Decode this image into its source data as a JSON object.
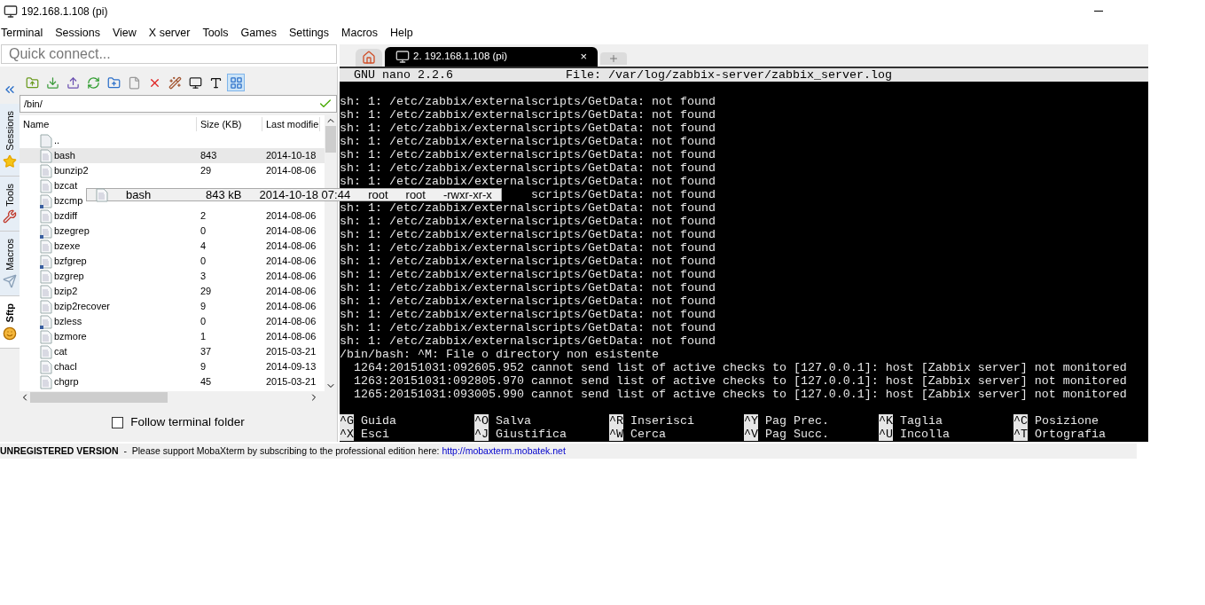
{
  "window": {
    "title": "192.168.1.108 (pi)"
  },
  "menu": [
    "Terminal",
    "Sessions",
    "View",
    "X server",
    "Tools",
    "Games",
    "Settings",
    "Macros",
    "Help"
  ],
  "quick_connect": {
    "placeholder": "Quick connect..."
  },
  "session_tabs": [
    {
      "kind": "home",
      "selected": false
    },
    {
      "kind": "session",
      "label": "2. 192.168.1.108 (pi)",
      "close": "×",
      "selected": true
    },
    {
      "kind": "new",
      "selected": false
    }
  ],
  "side_tabs": [
    {
      "label": "Sessions",
      "selected": false
    },
    {
      "label": "Tools",
      "selected": false
    },
    {
      "label": "Macros",
      "selected": false
    },
    {
      "label": "Sftp",
      "selected": true
    }
  ],
  "toolbar_buttons": [
    {
      "kind": "folder-up",
      "selected": false
    },
    {
      "kind": "download",
      "selected": false
    },
    {
      "kind": "upload",
      "selected": false
    },
    {
      "kind": "refresh",
      "selected": false
    },
    {
      "kind": "new-folder",
      "selected": false
    },
    {
      "kind": "new-file",
      "selected": false
    },
    {
      "kind": "delete",
      "selected": false
    },
    {
      "kind": "wand",
      "selected": false
    },
    {
      "kind": "terminal",
      "selected": false
    },
    {
      "kind": "text",
      "selected": false
    },
    {
      "kind": "view",
      "selected": true
    }
  ],
  "path": {
    "value": "/bin/"
  },
  "file_list": {
    "columns": [
      "Name",
      "Size (KB)",
      "Last modifie"
    ],
    "rows": [
      {
        "kind": "parent",
        "name": "..",
        "selected": false
      },
      {
        "kind": "file",
        "name": "bash",
        "size": "843",
        "date": "2014-10-18",
        "selected": true
      },
      {
        "kind": "file",
        "name": "bunzip2",
        "size": "29",
        "date": "2014-08-06",
        "selected": false
      },
      {
        "kind": "file",
        "name": "bzcat",
        "selected": false
      },
      {
        "kind": "link",
        "name": "bzcmp",
        "selected": false
      },
      {
        "kind": "file",
        "name": "bzdiff",
        "size": "2",
        "date": "2014-08-06",
        "selected": false
      },
      {
        "kind": "link",
        "name": "bzegrep",
        "size": "0",
        "date": "2014-08-06",
        "selected": false
      },
      {
        "kind": "file",
        "name": "bzexe",
        "size": "4",
        "date": "2014-08-06",
        "selected": false
      },
      {
        "kind": "link",
        "name": "bzfgrep",
        "size": "0",
        "date": "2014-08-06",
        "selected": false
      },
      {
        "kind": "file",
        "name": "bzgrep",
        "size": "3",
        "date": "2014-08-06",
        "selected": false
      },
      {
        "kind": "file",
        "name": "bzip2",
        "size": "29",
        "date": "2014-08-06",
        "selected": false
      },
      {
        "kind": "file",
        "name": "bzip2recover",
        "size": "9",
        "date": "2014-08-06",
        "selected": false
      },
      {
        "kind": "link",
        "name": "bzless",
        "size": "0",
        "date": "2014-08-06",
        "selected": false
      },
      {
        "kind": "file",
        "name": "bzmore",
        "size": "1",
        "date": "2014-08-06",
        "selected": false
      },
      {
        "kind": "file",
        "name": "cat",
        "size": "37",
        "date": "2015-03-21",
        "selected": false
      },
      {
        "kind": "file",
        "name": "chacl",
        "size": "9",
        "date": "2014-09-13",
        "selected": false
      },
      {
        "kind": "file",
        "name": "chgrp",
        "size": "45",
        "date": "2015-03-21",
        "selected": false
      }
    ]
  },
  "follow_terminal_folder": {
    "label": "Follow terminal folder",
    "checked": false
  },
  "tooltip": {
    "name": "bash",
    "size": "843 kB",
    "date": "2014-10-18 07:44",
    "owner": "root",
    "group": "root",
    "permissions": "-rwxr-xr-x"
  },
  "terminal": {
    "header": {
      "left": "GNU nano 2.2.6",
      "right": "File: /var/log/zabbix-server/zabbix_server.log"
    },
    "lines": [
      {
        "kind": "full",
        "text": "sh: 1: /etc/zabbix/externalscripts/GetData: not found"
      },
      {
        "kind": "full",
        "text": "sh: 1: /etc/zabbix/externalscripts/GetData: not found"
      },
      {
        "kind": "full",
        "text": "sh: 1: /etc/zabbix/externalscripts/GetData: not found"
      },
      {
        "kind": "full",
        "text": "sh: 1: /etc/zabbix/externalscripts/GetData: not found"
      },
      {
        "kind": "full",
        "text": "sh: 1: /etc/zabbix/externalscripts/GetData: not found"
      },
      {
        "kind": "full",
        "text": "sh: 1: /etc/zabbix/externalscripts/GetData: not found"
      },
      {
        "kind": "full",
        "text": "sh: 1: /etc/zabbix/externalscripts/GetData: not found"
      },
      {
        "kind": "covered",
        "text": "scripts/GetData: not found"
      },
      {
        "kind": "full",
        "text": "sh: 1: /etc/zabbix/externalscripts/GetData: not found"
      },
      {
        "kind": "full",
        "text": "sh: 1: /etc/zabbix/externalscripts/GetData: not found"
      },
      {
        "kind": "full",
        "text": "sh: 1: /etc/zabbix/externalscripts/GetData: not found"
      },
      {
        "kind": "full",
        "text": "sh: 1: /etc/zabbix/externalscripts/GetData: not found"
      },
      {
        "kind": "full",
        "text": "sh: 1: /etc/zabbix/externalscripts/GetData: not found"
      },
      {
        "kind": "full",
        "text": "sh: 1: /etc/zabbix/externalscripts/GetData: not found"
      },
      {
        "kind": "full",
        "text": "sh: 1: /etc/zabbix/externalscripts/GetData: not found"
      },
      {
        "kind": "full",
        "text": "sh: 1: /etc/zabbix/externalscripts/GetData: not found"
      },
      {
        "kind": "full",
        "text": "sh: 1: /etc/zabbix/externalscripts/GetData: not found"
      },
      {
        "kind": "full",
        "text": "sh: 1: /etc/zabbix/externalscripts/GetData: not found"
      },
      {
        "kind": "full",
        "text": "sh: 1: /etc/zabbix/externalscripts/GetData: not found"
      },
      {
        "kind": "full",
        "text": "/bin/bash: ^M: File o directory non esistente"
      },
      {
        "kind": "full",
        "text": "  1264:20151031:092605.952 cannot send list of active checks to [127.0.0.1]: host [Zabbix server] not monitored"
      },
      {
        "kind": "full",
        "text": "  1263:20151031:092805.970 cannot send list of active checks to [127.0.0.1]: host [Zabbix server] not monitored"
      },
      {
        "kind": "full",
        "text": "  1265:20151031:093005.990 cannot send list of active checks to [127.0.0.1]: host [Zabbix server] not monitored"
      }
    ],
    "shortcuts": [
      {
        "key": "^G",
        "label": "Guida"
      },
      {
        "key": "^O",
        "label": "Salva"
      },
      {
        "key": "^R",
        "label": "Inserisci"
      },
      {
        "key": "^Y",
        "label": "Pag Prec."
      },
      {
        "key": "^K",
        "label": "Taglia"
      },
      {
        "key": "^C",
        "label": "Posizione"
      },
      {
        "key": "^X",
        "label": "Esci"
      },
      {
        "key": "^J",
        "label": "Giustifica"
      },
      {
        "key": "^W",
        "label": "Cerca"
      },
      {
        "key": "^V",
        "label": "Pag Succ."
      },
      {
        "key": "^U",
        "label": "Incolla"
      },
      {
        "key": "^T",
        "label": "Ortografia"
      }
    ]
  },
  "status_bar": {
    "message": "**UNREGISTERED VERSION**  -  Please support MobaXterm by subscribing to the professional edition here: ",
    "link": "http://mobaxterm.mobatek.net"
  }
}
